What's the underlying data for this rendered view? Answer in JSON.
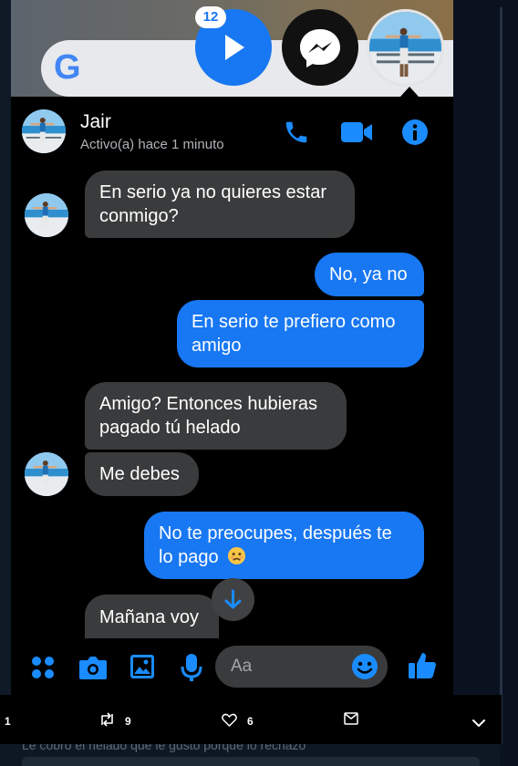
{
  "notification_count": "12",
  "contact": {
    "name": "Jair",
    "status": "Activo(a) hace 1 minuto"
  },
  "header_actions": [
    "phone-icon",
    "video-camera-icon",
    "info-icon"
  ],
  "messages": [
    {
      "from": "them",
      "text": "En serio ya no quieres estar conmigo?"
    },
    {
      "from": "me",
      "text": "No, ya no"
    },
    {
      "from": "me",
      "text": "En serio te prefiero como amigo"
    },
    {
      "from": "them",
      "text": "Amigo? Entonces hubieras pagado tú helado"
    },
    {
      "from": "them",
      "text": "Me debes"
    },
    {
      "from": "me",
      "text": "No te preocupes, después te lo pago",
      "emoji": "sad-face-emoji"
    },
    {
      "from": "them",
      "text": "Mañana voy"
    }
  ],
  "composer": {
    "placeholder": "Aa",
    "icons": [
      "menu-dots-icon",
      "camera-icon",
      "gallery-icon",
      "microphone-icon",
      "emoji-icon",
      "thumbs-up-icon"
    ]
  },
  "tweet_actions": {
    "reply_count": "1",
    "retweet_count": "9",
    "like_count": "6"
  },
  "next_tweet": {
    "partial_text": "Le cobro el helado que le gusto porque lo rechazo"
  },
  "colors": {
    "accent": "#1877f2",
    "received_bubble": "#3a3b3c",
    "background": "#000000"
  }
}
